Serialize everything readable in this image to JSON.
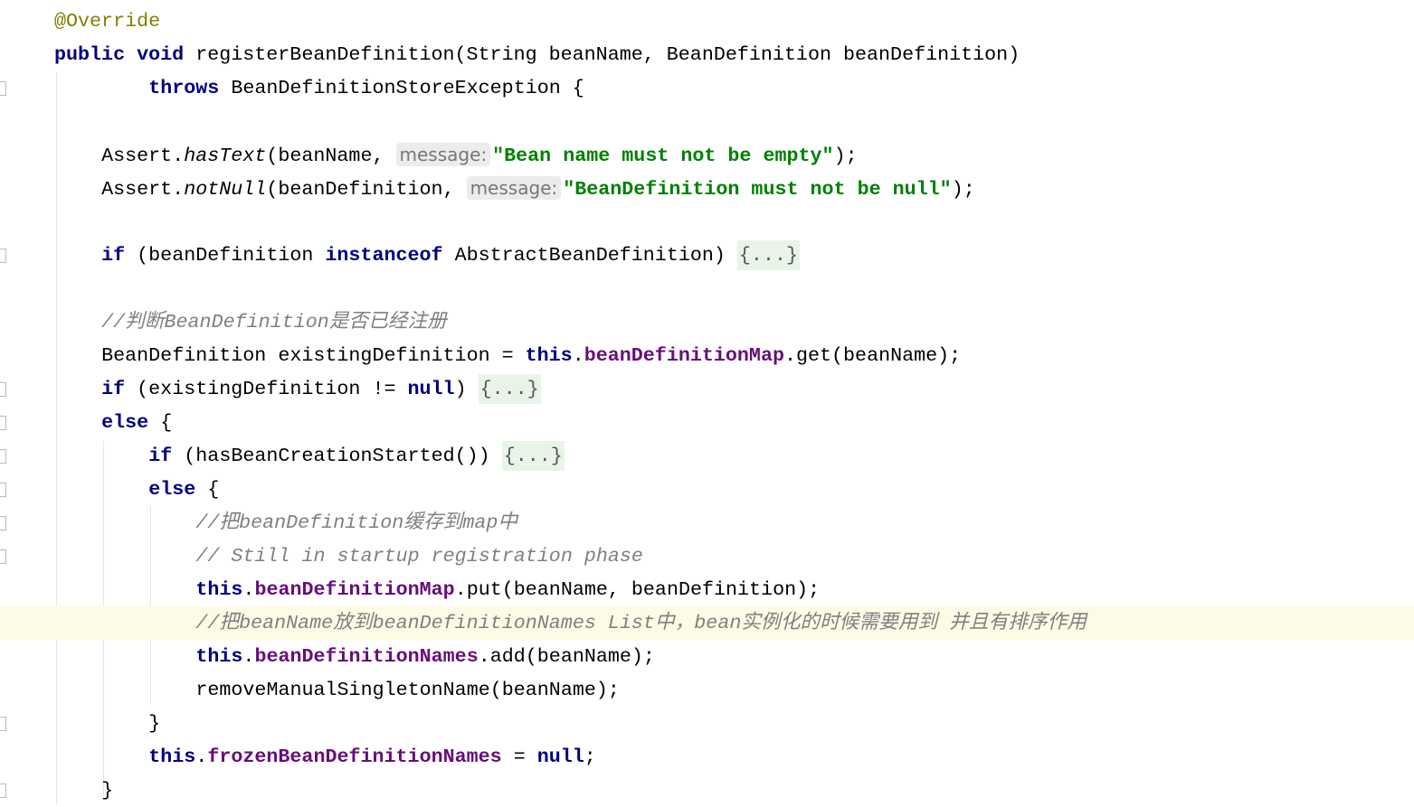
{
  "editor": {
    "language": "java",
    "current_line": 18,
    "colors": {
      "keyword": "#000080",
      "field": "#660e7a",
      "string": "#008000",
      "comment": "#808080",
      "annotation": "#808000",
      "current_line": "#fdfbe6"
    },
    "lines": [
      {
        "indent": 0,
        "tokens": [
          {
            "t": "@Override",
            "c": "ann"
          }
        ]
      },
      {
        "indent": 0,
        "tokens": [
          {
            "t": "public void ",
            "c": "kw"
          },
          {
            "t": "registerBeanDefinition(String beanName, BeanDefinition beanDefinition)"
          }
        ]
      },
      {
        "indent": 8,
        "tokens": [
          {
            "t": "throws ",
            "c": "kw"
          },
          {
            "t": "BeanDefinitionStoreException {"
          }
        ]
      },
      {
        "indent": 0,
        "tokens": []
      },
      {
        "indent": 4,
        "tokens": [
          {
            "t": "Assert."
          },
          {
            "t": "hasText",
            "c": "ital"
          },
          {
            "t": "(beanName, "
          },
          {
            "t": "message:",
            "c": "hint"
          },
          {
            "t": "\"Bean name must not be empty\"",
            "c": "str"
          },
          {
            "t": ");"
          }
        ]
      },
      {
        "indent": 4,
        "tokens": [
          {
            "t": "Assert."
          },
          {
            "t": "notNull",
            "c": "ital"
          },
          {
            "t": "(beanDefinition, "
          },
          {
            "t": "message:",
            "c": "hint"
          },
          {
            "t": "\"BeanDefinition must not be null\"",
            "c": "str"
          },
          {
            "t": ");"
          }
        ]
      },
      {
        "indent": 0,
        "tokens": []
      },
      {
        "indent": 4,
        "tokens": [
          {
            "t": "if ",
            "c": "kw"
          },
          {
            "t": "(beanDefinition "
          },
          {
            "t": "instanceof ",
            "c": "kw"
          },
          {
            "t": "AbstractBeanDefinition) "
          },
          {
            "t": "{...}",
            "c": "fold"
          }
        ]
      },
      {
        "indent": 0,
        "tokens": []
      },
      {
        "indent": 4,
        "tokens": [
          {
            "t": "//判断BeanDefinition是否已经注册",
            "c": "cmt"
          }
        ]
      },
      {
        "indent": 4,
        "tokens": [
          {
            "t": "BeanDefinition existingDefinition = "
          },
          {
            "t": "this",
            "c": "kw"
          },
          {
            "t": "."
          },
          {
            "t": "beanDefinitionMap",
            "c": "field"
          },
          {
            "t": ".get(beanName);"
          }
        ]
      },
      {
        "indent": 4,
        "tokens": [
          {
            "t": "if ",
            "c": "kw"
          },
          {
            "t": "(existingDefinition != "
          },
          {
            "t": "null",
            "c": "kw"
          },
          {
            "t": ") "
          },
          {
            "t": "{...}",
            "c": "fold"
          }
        ]
      },
      {
        "indent": 4,
        "tokens": [
          {
            "t": "else ",
            "c": "kw"
          },
          {
            "t": "{"
          }
        ]
      },
      {
        "indent": 8,
        "tokens": [
          {
            "t": "if ",
            "c": "kw"
          },
          {
            "t": "(hasBeanCreationStarted()) "
          },
          {
            "t": "{...}",
            "c": "fold"
          }
        ]
      },
      {
        "indent": 8,
        "tokens": [
          {
            "t": "else ",
            "c": "kw"
          },
          {
            "t": "{"
          }
        ]
      },
      {
        "indent": 12,
        "tokens": [
          {
            "t": "//把beanDefinition缓存到map中",
            "c": "cmt"
          }
        ]
      },
      {
        "indent": 12,
        "tokens": [
          {
            "t": "// Still in startup registration phase",
            "c": "cmt"
          }
        ]
      },
      {
        "indent": 12,
        "tokens": [
          {
            "t": "this",
            "c": "kw"
          },
          {
            "t": "."
          },
          {
            "t": "beanDefinitionMap",
            "c": "field"
          },
          {
            "t": ".put(beanName, beanDefinition);"
          }
        ]
      },
      {
        "indent": 12,
        "tokens": [
          {
            "t": "//把beanName放到beanDefinitionNames List中，bean实例化的时候需要用到 并且有排序作用",
            "c": "cmt"
          }
        ]
      },
      {
        "indent": 12,
        "tokens": [
          {
            "t": "this",
            "c": "kw"
          },
          {
            "t": "."
          },
          {
            "t": "beanDefinitionNames",
            "c": "field"
          },
          {
            "t": ".add(beanName);"
          }
        ]
      },
      {
        "indent": 12,
        "tokens": [
          {
            "t": "removeManualSingletonName(beanName);"
          }
        ]
      },
      {
        "indent": 8,
        "tokens": [
          {
            "t": "}"
          }
        ]
      },
      {
        "indent": 8,
        "tokens": [
          {
            "t": "this",
            "c": "kw"
          },
          {
            "t": "."
          },
          {
            "t": "frozenBeanDefinitionNames",
            "c": "field"
          },
          {
            "t": " = "
          },
          {
            "t": "null",
            "c": "kw"
          },
          {
            "t": ";"
          }
        ]
      },
      {
        "indent": 4,
        "tokens": [
          {
            "t": "}"
          }
        ]
      }
    ]
  }
}
